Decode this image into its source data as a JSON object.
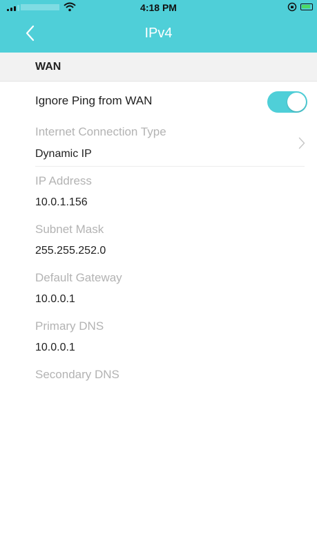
{
  "status_bar": {
    "time": "4:18 PM"
  },
  "nav": {
    "title": "IPv4"
  },
  "section": {
    "title": "WAN"
  },
  "settings": {
    "ignore_ping_label": "Ignore Ping from WAN",
    "ignore_ping_enabled": true,
    "connection_type_label": "Internet Connection Type",
    "connection_type_value": "Dynamic IP"
  },
  "fields": [
    {
      "label": "IP Address",
      "value": "10.0.1.156"
    },
    {
      "label": "Subnet Mask",
      "value": "255.255.252.0"
    },
    {
      "label": "Default Gateway",
      "value": "10.0.0.1"
    },
    {
      "label": "Primary DNS",
      "value": "10.0.0.1"
    },
    {
      "label": "Secondary DNS",
      "value": ""
    }
  ],
  "colors": {
    "accent": "#4fcfd8",
    "label_gray": "#b3b3b3",
    "text_dark": "#1f1f1f"
  },
  "icons": {
    "back": "chevron-left-icon",
    "disclosure": "chevron-right-icon",
    "wifi": "wifi-icon",
    "signal": "signal-bars-icon",
    "battery": "battery-charging-icon",
    "rotation_lock": "rotation-lock-icon"
  }
}
